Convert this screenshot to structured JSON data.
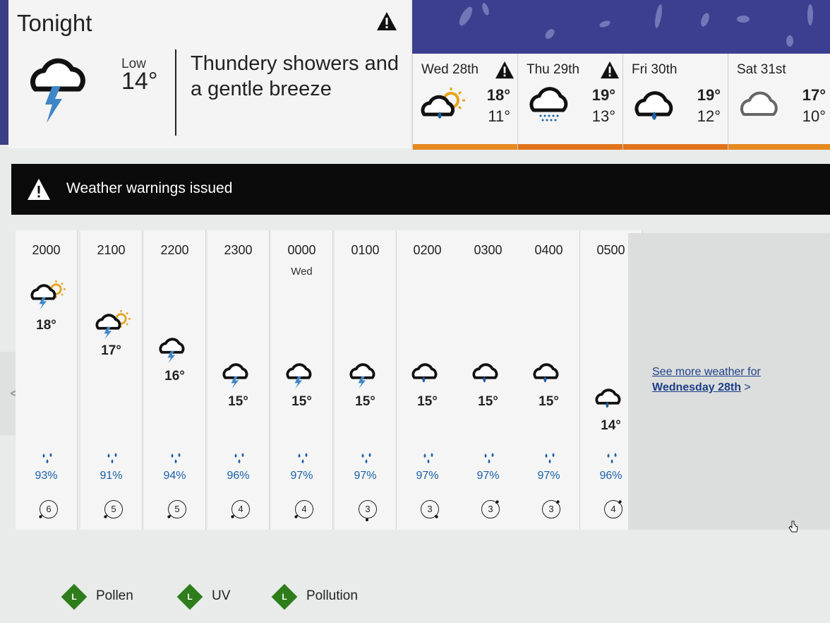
{
  "tonight": {
    "title": "Tonight",
    "low_label": "Low",
    "low_value": "14°",
    "description": "Thundery showers and a gentle breeze",
    "icon": "thunder-shower-night-icon",
    "has_warning": true
  },
  "days": [
    {
      "name": "Wed 28th",
      "high": "18°",
      "low": "11°",
      "icon": "sunny-intervals-rain-icon",
      "warning": true,
      "bar_color": "#e58a1f"
    },
    {
      "name": "Thu 29th",
      "high": "19°",
      "low": "13°",
      "icon": "drizzle-cloud-icon",
      "warning": true,
      "bar_color": "#e0731c"
    },
    {
      "name": "Fri 30th",
      "high": "19°",
      "low": "12°",
      "icon": "light-rain-cloud-icon",
      "warning": false,
      "bar_color": "#e0731c"
    },
    {
      "name": "Sat 31st",
      "high": "17°",
      "low": "10°",
      "icon": "cloud-icon",
      "warning": false,
      "bar_color": "#e58a1f"
    }
  ],
  "warning_banner": {
    "text": "Weather warnings issued",
    "icon": "warning-triangle-icon"
  },
  "hourly": [
    {
      "time": "2000",
      "day": "",
      "temp": "18°",
      "icon": "thunder-sun-icon",
      "rain": "93%",
      "wind": "6",
      "wind_dir": "SW"
    },
    {
      "time": "2100",
      "day": "",
      "temp": "17°",
      "icon": "thunder-sun-icon",
      "rain": "91%",
      "wind": "5",
      "wind_dir": "SW"
    },
    {
      "time": "2200",
      "day": "",
      "temp": "16°",
      "icon": "thunder-moon-icon",
      "rain": "94%",
      "wind": "5",
      "wind_dir": "SW"
    },
    {
      "time": "2300",
      "day": "",
      "temp": "15°",
      "icon": "thunder-moon-icon",
      "rain": "96%",
      "wind": "4",
      "wind_dir": "SW"
    },
    {
      "time": "0000",
      "day": "Wed",
      "temp": "15°",
      "icon": "thunder-moon-icon",
      "rain": "97%",
      "wind": "4",
      "wind_dir": "SW"
    },
    {
      "time": "0100",
      "day": "",
      "temp": "15°",
      "icon": "thunder-moon-icon",
      "rain": "97%",
      "wind": "3",
      "wind_dir": "S"
    },
    {
      "time": "0200",
      "day": "",
      "temp": "15°",
      "icon": "rain-moon-icon",
      "rain": "97%",
      "wind": "3",
      "wind_dir": "SE"
    },
    {
      "time": "0300",
      "day": "",
      "temp": "15°",
      "icon": "rain-moon-icon",
      "rain": "97%",
      "wind": "3",
      "wind_dir": "NE"
    },
    {
      "time": "0400",
      "day": "",
      "temp": "15°",
      "icon": "rain-moon-icon",
      "rain": "97%",
      "wind": "3",
      "wind_dir": "NE"
    },
    {
      "time": "0500",
      "day": "",
      "temp": "14°",
      "icon": "rain-moon-icon",
      "rain": "96%",
      "wind": "4",
      "wind_dir": "NE"
    }
  ],
  "see_more": {
    "line1": "See more weather for",
    "line2": "Wednesday 28th",
    "chevron": ">"
  },
  "prev_arrow": "<",
  "indices": [
    {
      "letter": "L",
      "label": "Pollen"
    },
    {
      "letter": "L",
      "label": "UV"
    },
    {
      "letter": "L",
      "label": "Pollution"
    }
  ],
  "colors": {
    "banner": "#0b0b0b",
    "rain_text": "#1c5fa8",
    "link": "#1d3f87",
    "index_green": "#2e7d1a",
    "lightning": "#3f86c6",
    "sun": "#e5a51f"
  }
}
